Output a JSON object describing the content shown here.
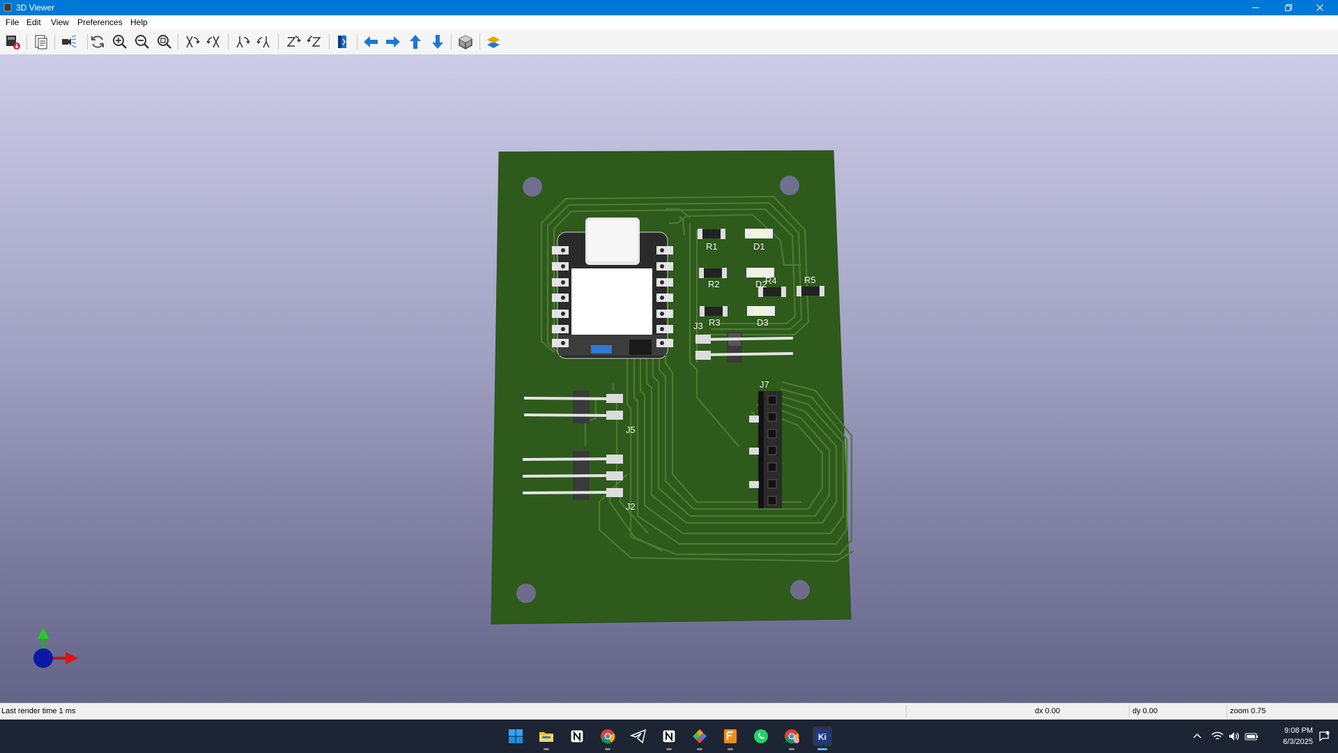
{
  "window": {
    "title": "3D Viewer"
  },
  "menu": [
    "File",
    "Edit",
    "View",
    "Preferences",
    "Help"
  ],
  "toolbar": {
    "buttons": [
      "export-image-icon",
      "copy-clipboard-icon",
      "raytrace-icon",
      "reload-icon",
      "zoom-in-icon",
      "zoom-out-icon",
      "zoom-fit-icon",
      "rotate-x-cw-icon",
      "rotate-x-ccw-icon",
      "rotate-y-cw-icon",
      "rotate-y-ccw-icon",
      "rotate-z-cw-icon",
      "rotate-z-ccw-icon",
      "flip-board-icon",
      "pan-left-icon",
      "pan-right-icon",
      "pan-up-icon",
      "pan-down-icon",
      "ortho-icon",
      "layers-icon"
    ]
  },
  "board": {
    "references": [
      "R1",
      "D1",
      "R2",
      "D2",
      "R4",
      "R5",
      "R3",
      "D3",
      "J3",
      "J7",
      "J5",
      "J2"
    ]
  },
  "status": {
    "message": "Last render time 1 ms",
    "dx": "dx 0.00",
    "dy": "dy 0.00",
    "zoom": "zoom 0.75"
  },
  "taskbar": {
    "apps": [
      "windows-start-icon",
      "file-explorer-icon",
      "notion-icon",
      "chrome-icon",
      "telegram-icon",
      "notion-icon",
      "git-icon",
      "fusion-icon",
      "whatsapp-icon",
      "chrome-profile-icon",
      "kicad-icon"
    ],
    "time": "9:08 PM",
    "date": "6/3/2025"
  },
  "colors": {
    "accent": "#0078d7",
    "board": "#2e5a1c",
    "trace": "#4f7a33",
    "taskbar": "#1d2433"
  }
}
